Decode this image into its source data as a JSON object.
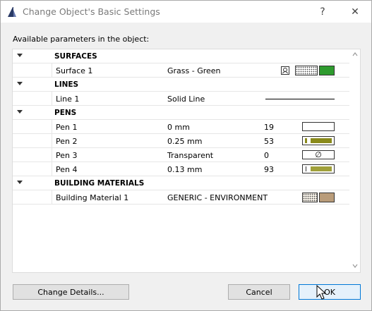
{
  "window": {
    "title": "Change Object's Basic Settings",
    "help_glyph": "?",
    "close_glyph": "✕"
  },
  "available_label": "Available parameters in the object:",
  "groups": {
    "surfaces": {
      "title": "SURFACES",
      "items": [
        {
          "name": "Surface 1",
          "value": "Grass - Green",
          "color": "#2e9b2e"
        }
      ]
    },
    "lines": {
      "title": "LINES",
      "items": [
        {
          "name": "Line 1",
          "value": "Solid Line"
        }
      ]
    },
    "pens": {
      "title": "PENS",
      "items": [
        {
          "name": "Pen 1",
          "value": "0 mm",
          "num": "19",
          "fill_fraction": 0.0
        },
        {
          "name": "Pen 2",
          "value": "0.25 mm",
          "num": "53",
          "fill_fraction": 0.9
        },
        {
          "name": "Pen 3",
          "value": "Transparent",
          "num": "0",
          "glyph": "∅"
        },
        {
          "name": "Pen 4",
          "value": "0.13 mm",
          "num": "93",
          "fill_fraction": 0.85
        }
      ]
    },
    "building_materials": {
      "title": "BUILDING MATERIALS",
      "items": [
        {
          "name": "Building Material 1",
          "value": "GENERIC - ENVIRONMENT",
          "color": "#b99c7a"
        }
      ]
    }
  },
  "buttons": {
    "change_details": "Change Details...",
    "cancel": "Cancel",
    "ok": "OK"
  }
}
